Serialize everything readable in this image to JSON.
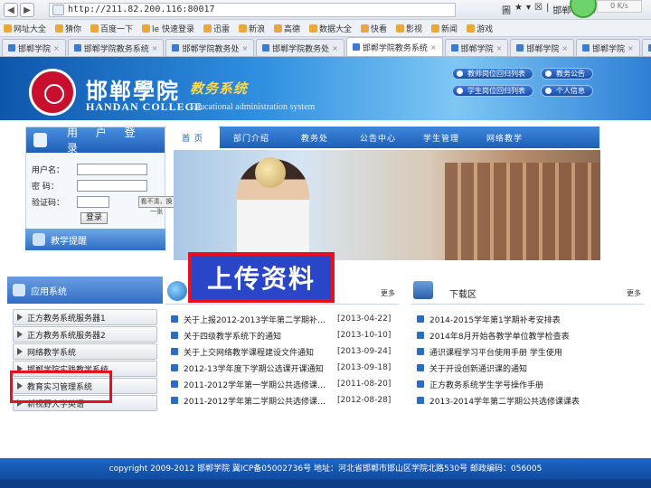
{
  "browser": {
    "url": "http://211.82.200.116:80017",
    "right_items": [
      "圖",
      "★",
      "▾",
      "☒",
      "|",
      "邯郸学院 ▾"
    ],
    "bubble_text": "0 K/s",
    "favorites": [
      "网址大全",
      "猜你",
      "百度一下",
      "le 快速登录",
      "迅雷",
      "新浪",
      "高德",
      "数据大全",
      "快看",
      "影视",
      "新闻",
      "游戏"
    ],
    "tabs": [
      "邯郸学院",
      "邯郸学院教务系统",
      "邯郸学院教务处",
      "邯郸学院教务处",
      "邯郸学院教务系统",
      "邯郸学院",
      "邯郸学院",
      "邯郸学院",
      "邯郸学院",
      "邯郸学院"
    ]
  },
  "header": {
    "college_name": "邯郸學院",
    "system_name": "教务系统",
    "college_en": "HANDAN COLLEGE",
    "system_en": "Educational administration system",
    "buttons": [
      "教师岗位回归列表",
      "教务公告",
      "学生岗位回归列表",
      "个人信息"
    ]
  },
  "login": {
    "title": "用 户 登 录",
    "username_label": "用户名：",
    "password_label": "密  码：",
    "captcha_label": "验证码：",
    "captcha_text": "看不清，换一张",
    "submit_label": "登录"
  },
  "notice": {
    "title": "教学提醒"
  },
  "apps": {
    "title": "应用系统",
    "items": [
      "正方教务系统服务器1",
      "正方教务系统服务器2",
      "网络教学系统",
      "邯郸学院实践教学系统",
      "教育实习管理系统",
      "新视野大学英语"
    ]
  },
  "nav": [
    "首 页",
    "部门介绍",
    "教务处",
    "公告中心",
    "学生管理",
    "网络教学"
  ],
  "upload_label": "上传资料",
  "news": {
    "title": "",
    "more": "更多",
    "rows": [
      {
        "title": "关于上报2012-2013学年第二学期补…",
        "date": "[2013-04-22]"
      },
      {
        "title": "关于四级教学系统下的通知",
        "date": "[2013-10-10]"
      },
      {
        "title": "关于上交网络教学课程建设文件通知",
        "date": "[2013-09-24]"
      },
      {
        "title": "2012-13学年度下学期公选课开课通知",
        "date": "[2013-09-18]"
      },
      {
        "title": "2011-2012学年第一学期公共选修课…",
        "date": "[2011-08-20]"
      },
      {
        "title": "2011-2012学年第二学期公共选修课…",
        "date": "[2012-08-28]"
      }
    ]
  },
  "download": {
    "title": "下载区",
    "more": "更多",
    "rows": [
      "2014-2015学年第1学期补考安排表",
      "2014年8月开始各教学单位教学检查表",
      "通识课程学习平台使用手册 学生使用",
      "关于开设创新通识课的通知",
      "正方教务系统学生学号操作手册",
      "2013-2014学年第二学期公共选修课课表"
    ]
  },
  "footer": "copyright 2009-2012 邯郸学院 冀ICP备05002736号 地址：河北省邯郸市邯山区学院北路530号 邮政编码：056005"
}
